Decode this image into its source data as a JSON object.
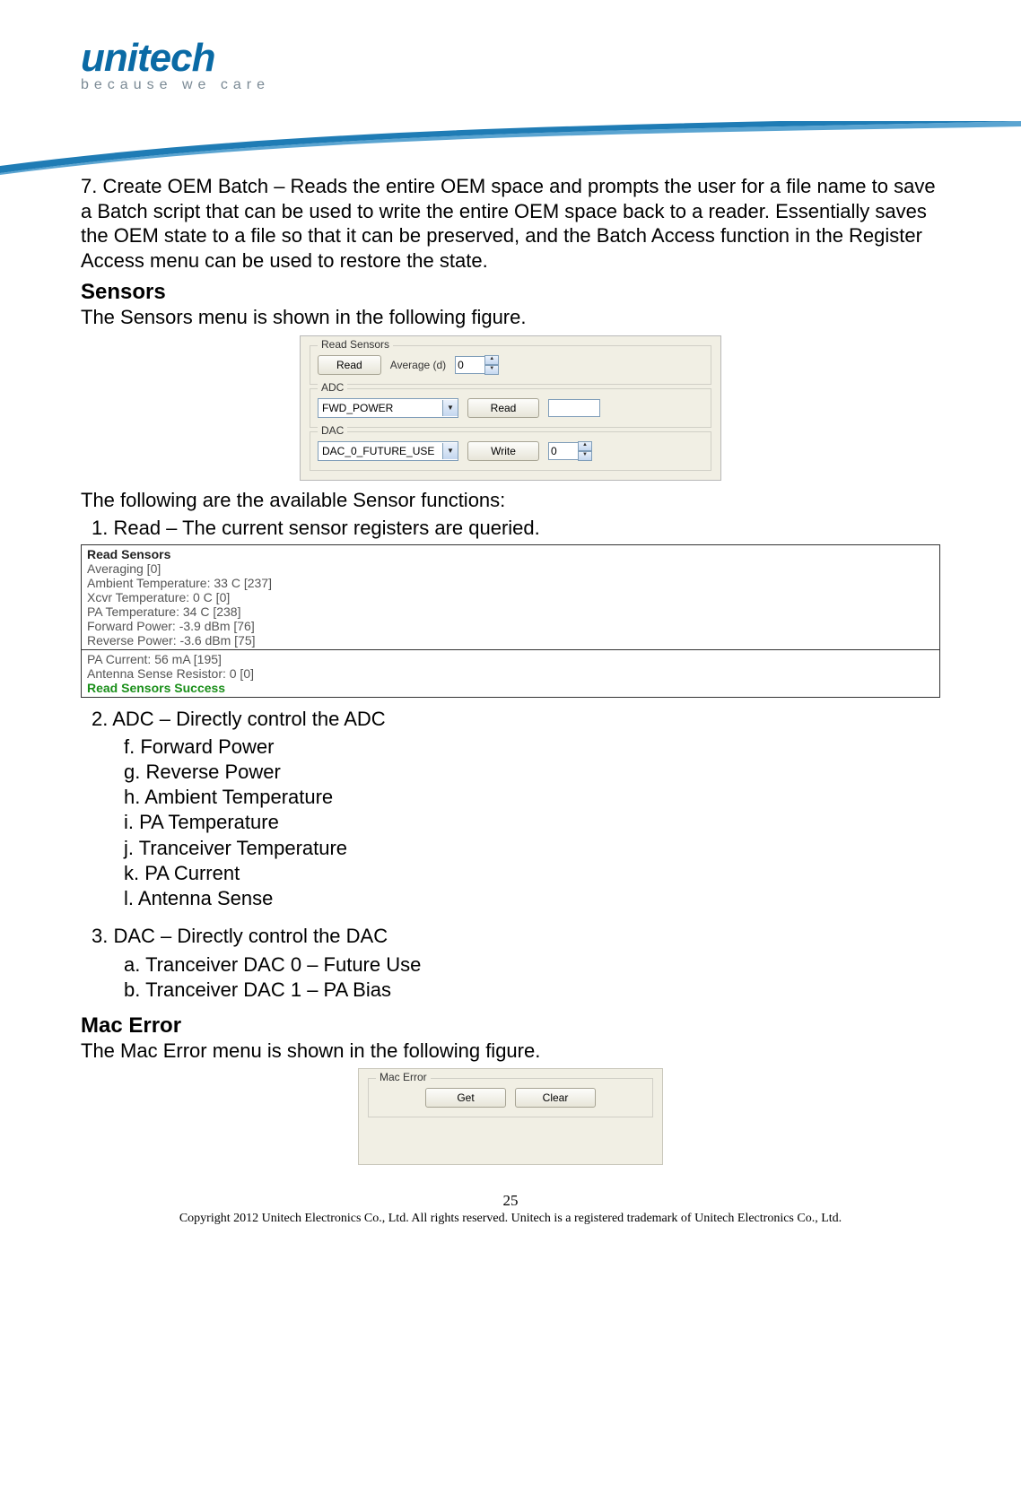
{
  "logo": {
    "brand": "unitech",
    "tagline": "because we care"
  },
  "para7": "7.    Create OEM Batch – Reads the entire OEM space and prompts the user for a file name to save a Batch script that can be used to write the entire OEM space back to a reader. Essentially saves the OEM state to a file so that it can be preserved, and the Batch Access function in the Register Access menu can be used to restore the state.",
  "sensors": {
    "title": "Sensors",
    "intro": "The Sensors menu is shown in the following figure.",
    "figure": {
      "readGroupTitle": "Read Sensors",
      "readButton": "Read",
      "averageLabel": "Average (d)",
      "averageValue": "0",
      "adcGroupTitle": "ADC",
      "adcSelected": "FWD_POWER",
      "adcReadButton": "Read",
      "dacGroupTitle": "DAC",
      "dacSelected": "DAC_0_FUTURE_USE",
      "dacWriteButton": "Write",
      "dacValue": "0"
    },
    "funcIntro": "The following are the available Sensor functions:",
    "item1": "1.  Read – The current sensor registers are queried.",
    "readOutput": {
      "title": "Read Sensors",
      "lines1": [
        "Averaging [0]",
        "Ambient Temperature: 33 C [237]",
        "Xcvr Temperature: 0 C [0]",
        "PA Temperature: 34 C [238]",
        "Forward Power: -3.9 dBm [76]",
        "Reverse Power: -3.6 dBm [75]"
      ],
      "lines2": [
        "PA Current: 56 mA [195]",
        "Antenna Sense Resistor: 0 [0]"
      ],
      "success": "Read Sensors Success"
    },
    "item2": "2.  ADC – Directly control the ADC",
    "adcSubs": [
      "f.    Forward Power",
      "g.  Reverse Power",
      "h.  Ambient Temperature",
      "i.    PA Temperature",
      "j.    Tranceiver Temperature",
      "k.  PA Current",
      "l.    Antenna Sense"
    ],
    "item3": "3.  DAC – Directly control the DAC",
    "dacSubs": [
      "a.  Tranceiver DAC 0 – Future Use",
      "b.  Tranceiver DAC 1 – PA Bias"
    ]
  },
  "macError": {
    "title": "Mac  Error",
    "intro": "The Mac Error menu is shown in the following figure.",
    "groupTitle": "Mac Error",
    "getButton": "Get",
    "clearButton": "Clear"
  },
  "footer": {
    "pageNum": "25",
    "copyright": "Copyright 2012 Unitech Electronics Co., Ltd. All rights reserved. Unitech is a registered trademark of Unitech Electronics Co., Ltd."
  }
}
